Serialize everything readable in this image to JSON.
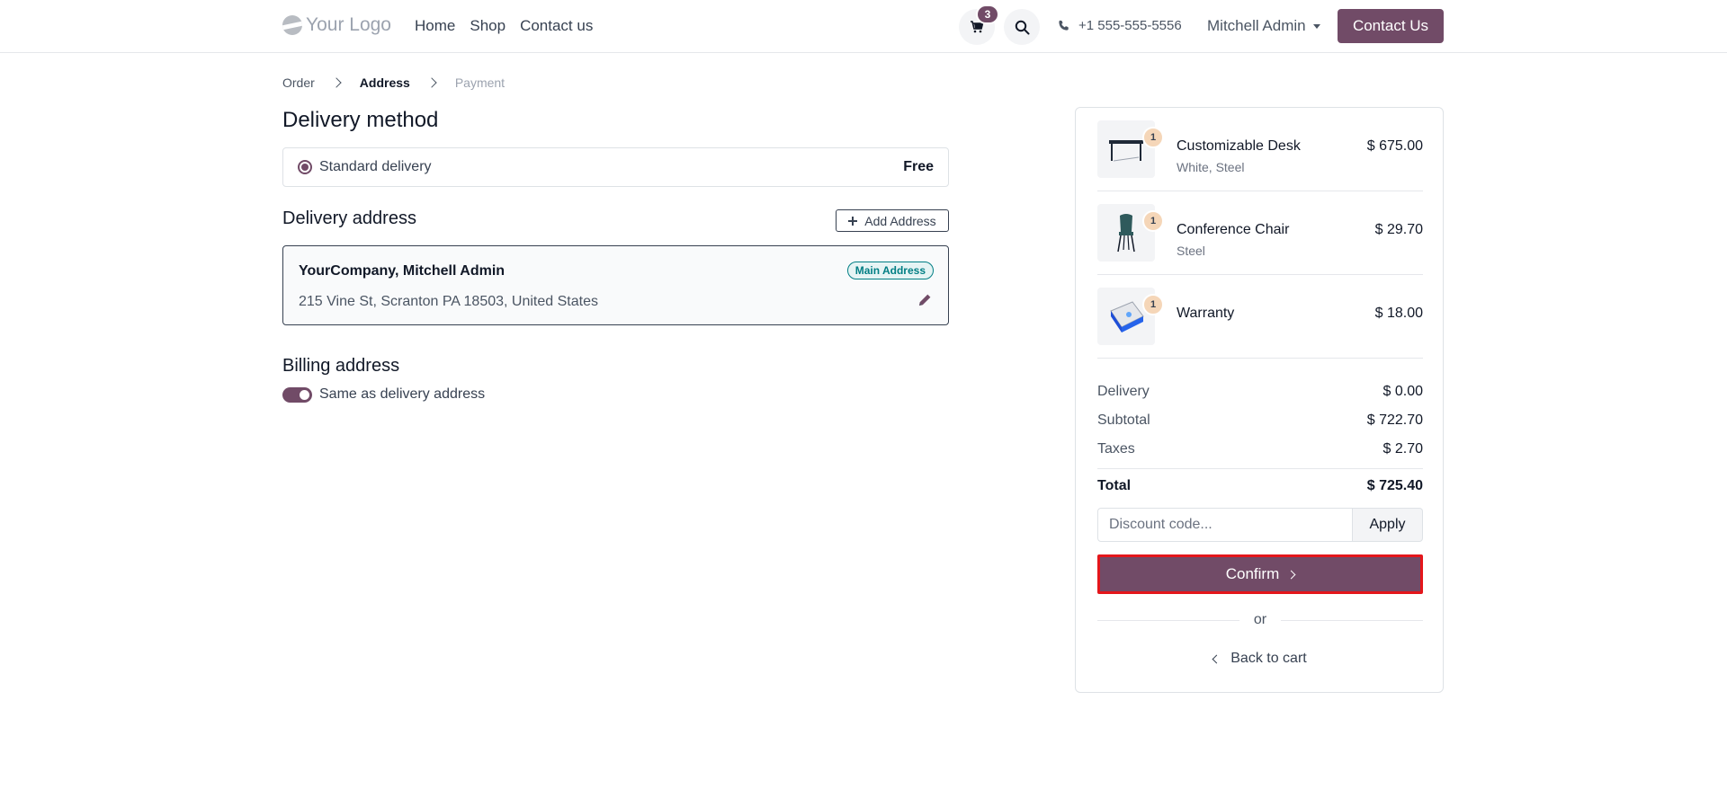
{
  "header": {
    "logo_text": "Your Logo",
    "nav": [
      {
        "label": "Home"
      },
      {
        "label": "Shop"
      },
      {
        "label": "Contact us"
      }
    ],
    "cart_count": "3",
    "phone": "+1 555-555-5556",
    "user": "Mitchell Admin",
    "contact_button": "Contact Us"
  },
  "breadcrumb": [
    "Order",
    "Address",
    "Payment"
  ],
  "delivery_method": {
    "title": "Delivery method",
    "option_label": "Standard delivery",
    "option_price": "Free"
  },
  "delivery_address": {
    "title": "Delivery address",
    "add_button": "Add Address",
    "name": "YourCompany, Mitchell Admin",
    "address": "215 Vine St, Scranton PA 18503, United States",
    "badge": "Main Address"
  },
  "billing": {
    "title": "Billing address",
    "toggle_label": "Same as delivery address"
  },
  "summary": {
    "items": [
      {
        "qty": "1",
        "name": "Customizable Desk",
        "variant": "White, Steel",
        "price": "$ 675.00"
      },
      {
        "qty": "1",
        "name": "Conference Chair",
        "variant": "Steel",
        "price": "$ 29.70"
      },
      {
        "qty": "1",
        "name": "Warranty",
        "variant": "",
        "price": "$ 18.00"
      }
    ],
    "delivery_label": "Delivery",
    "delivery_value": "$ 0.00",
    "subtotal_label": "Subtotal",
    "subtotal_value": "$ 722.70",
    "taxes_label": "Taxes",
    "taxes_value": "$ 2.70",
    "total_label": "Total",
    "total_value": "$ 725.40",
    "discount_placeholder": "Discount code...",
    "apply_label": "Apply",
    "confirm_label": "Confirm",
    "or_label": "or",
    "back_label": "Back to cart"
  },
  "colors": {
    "brand": "#714b67",
    "highlight_border": "#e4161b",
    "badge_teal": "#017e84"
  }
}
